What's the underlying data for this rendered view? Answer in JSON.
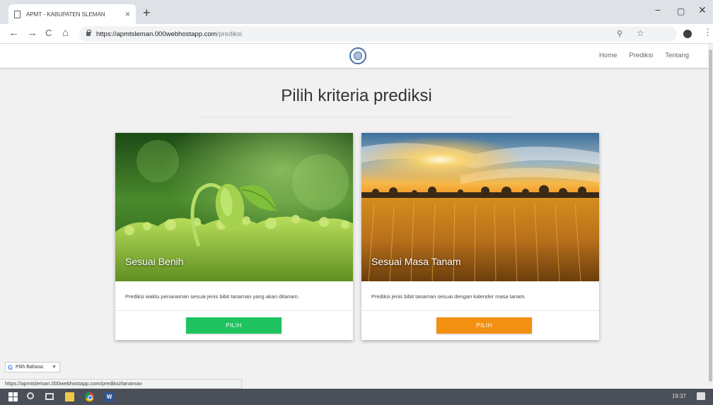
{
  "browser": {
    "tab_title": "APMT - KABUPATEN SLEMAN",
    "tab_close": "×",
    "new_tab": "+",
    "win_minimize": "−",
    "win_maximize": "▢",
    "win_close": "✕",
    "nav_back": "←",
    "nav_forward": "→",
    "nav_reload": "C",
    "nav_home": "⌂",
    "url_host": "https://apmtsleman.000webhostapp.com",
    "url_path": "/prediksi",
    "zoom_icon": "⚲",
    "star_icon": "☆",
    "menu_icon": "⋮"
  },
  "site": {
    "logo_icon": "site-logo",
    "nav": [
      "Home",
      "Prediksi",
      "Tentang"
    ]
  },
  "page": {
    "title": "Pilih kriteria prediksi",
    "cards": [
      {
        "caption": "Sesuai Benih",
        "description": "Prediksi waktu penanaman sesuai jenis bibit tanaman yang akan ditanam.",
        "button": "PILIH",
        "button_color": "#1ec35f"
      },
      {
        "caption": "Sesuai Masa Tanam",
        "description": "Prediksi jenis bibit tanaman sesuai dengan kalender masa tanam.",
        "button": "PILIH",
        "button_color": "#f39012"
      }
    ]
  },
  "footer": {
    "translate_g": "G",
    "translate_label": "Pilih Bahasa",
    "translate_caret": "▼",
    "status_url": "https://apmtsleman.000webhostapp.com/prediksi/tanaman"
  },
  "taskbar": {
    "word_letter": "W",
    "tray_time": "19:37"
  }
}
